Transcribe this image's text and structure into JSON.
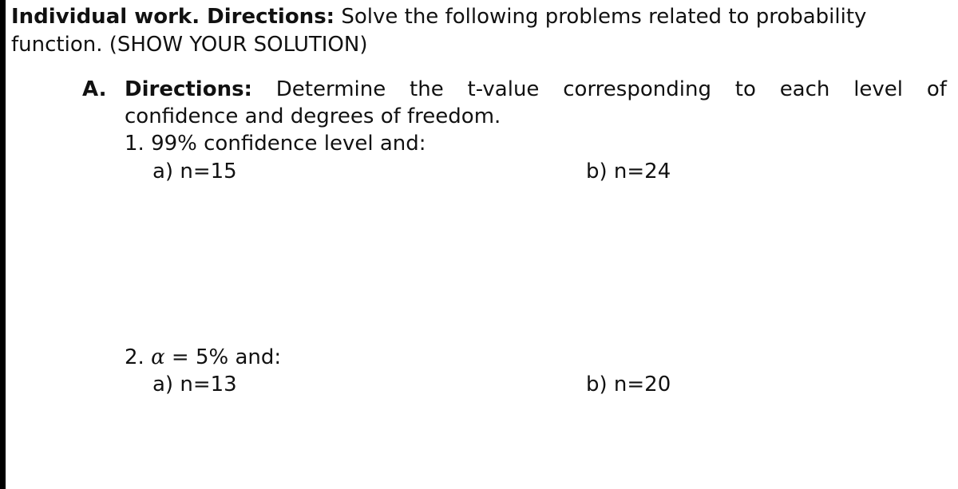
{
  "header": {
    "bold_lead": "Individual work. Directions:",
    "line1_rest": " Solve the following problems related to probability",
    "line2": "function. (SHOW YOUR SOLUTION)"
  },
  "section_a": {
    "label": "A.",
    "directions_label": "Directions:",
    "directions_words": [
      "Determine",
      "the",
      "t-value",
      "corresponding",
      "to",
      "each",
      "level",
      "of"
    ],
    "directions_line2": "confidence and degrees of freedom.",
    "problems": [
      {
        "number": "1.",
        "prompt": "99% confidence level and:",
        "parts": [
          {
            "label": "a)",
            "value": "n=15"
          },
          {
            "label": "b)",
            "value": "n=24"
          }
        ]
      },
      {
        "number": "2.",
        "prompt_symbol": "α",
        "prompt": " = 5% and:",
        "parts": [
          {
            "label": "a)",
            "value": "n=13"
          },
          {
            "label": "b)",
            "value": "n=20"
          }
        ]
      }
    ]
  }
}
